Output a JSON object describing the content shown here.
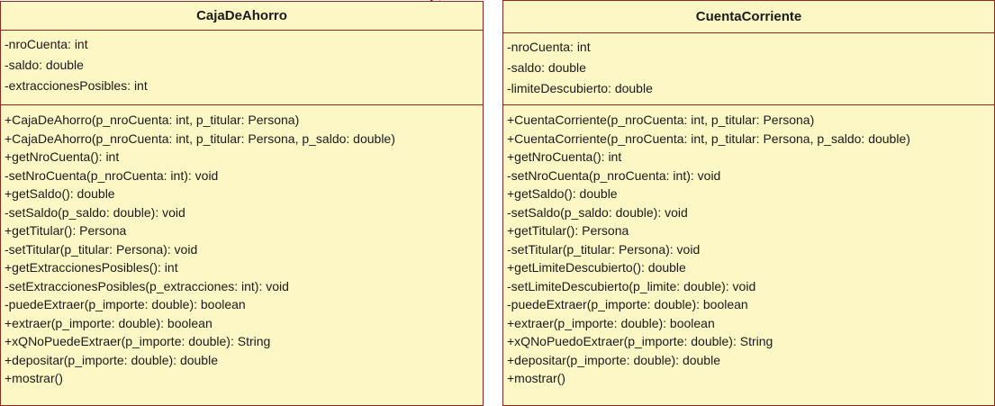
{
  "colors": {
    "class_fill": "#fdf7c5",
    "class_border": "#8b2a1e",
    "connector": "#8b2a1e"
  },
  "classes": [
    {
      "name": "CajaDeAhorro",
      "attributes": [
        "-nroCuenta: int",
        "-saldo: double",
        "-extraccionesPosibles: int"
      ],
      "methods": [
        "+CajaDeAhorro(p_nroCuenta: int, p_titular: Persona)",
        "+CajaDeAhorro(p_nroCuenta: int, p_titular: Persona, p_saldo: double)",
        "+getNroCuenta(): int",
        "-setNroCuenta(p_nroCuenta: int): void",
        "+getSaldo(): double",
        "-setSaldo(p_saldo: double): void",
        "+getTitular(): Persona",
        "-setTitular(p_titular: Persona): void",
        "+getExtraccionesPosibles(): int",
        "-setExtraccionesPosibles(p_extracciones: int): void",
        "-puedeExtraer(p_importe: double): boolean",
        "+extraer(p_importe: double): boolean",
        "+xQNoPuedeExtraer(p_importe: double): String",
        "+depositar(p_importe: double): double",
        "+mostrar()"
      ]
    },
    {
      "name": "CuentaCorriente",
      "attributes": [
        "-nroCuenta: int",
        "-saldo: double",
        "-limiteDescubierto: double"
      ],
      "methods": [
        "+CuentaCorriente(p_nroCuenta: int, p_titular: Persona)",
        "+CuentaCorriente(p_nroCuenta: int, p_titular: Persona, p_saldo: double)",
        "+getNroCuenta(): int",
        "-setNroCuenta(p_nroCuenta: int): void",
        "+getSaldo(): double",
        "-setSaldo(p_saldo: double): void",
        "+getTitular(): Persona",
        "-setTitular(p_titular: Persona): void",
        "+getLimiteDescubierto(): double",
        "-setLimiteDescubierto(p_limite: double): void",
        "-puedeExtraer(p_importe: double): boolean",
        "+extraer(p_importe: double): boolean",
        "+xQNoPuedoExtraer(p_importe: double): String",
        "+depositar(p_importe: double): double",
        "+mostrar()"
      ]
    }
  ]
}
